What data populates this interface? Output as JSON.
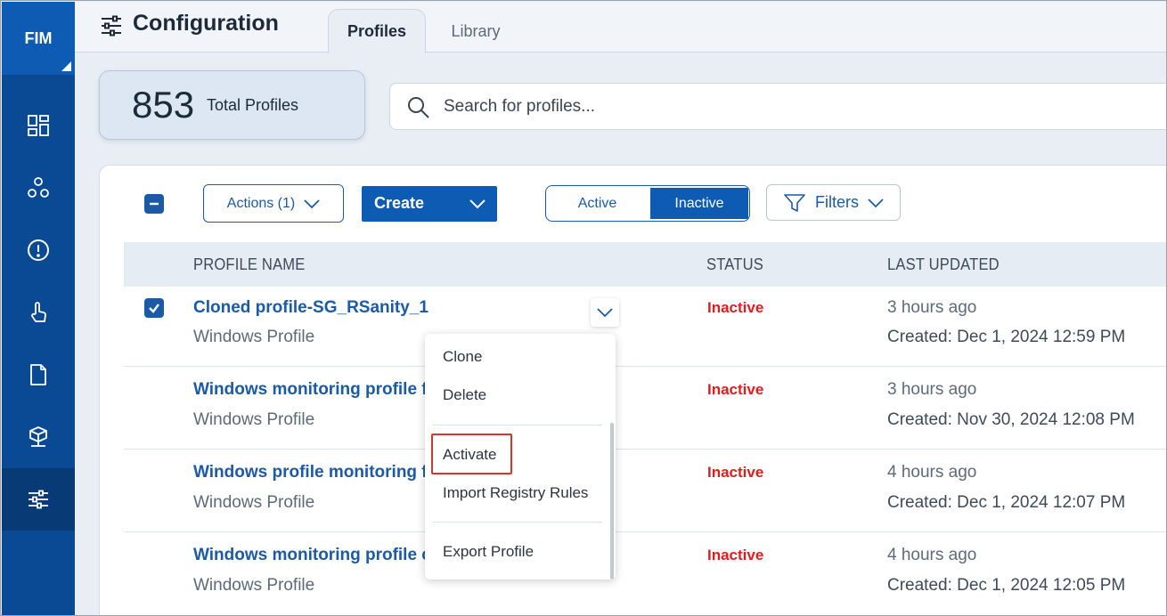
{
  "app": {
    "brand": "FIM"
  },
  "sidebar": {
    "items": [
      {
        "icon": "dashboard-icon"
      },
      {
        "icon": "network-nodes-icon"
      },
      {
        "icon": "alert-circle-icon"
      },
      {
        "icon": "touch-hand-icon"
      },
      {
        "icon": "document-icon"
      },
      {
        "icon": "package-icon"
      },
      {
        "icon": "sliders-icon",
        "active": true
      }
    ]
  },
  "header": {
    "title": "Configuration",
    "tabs": [
      {
        "label": "Profiles",
        "selected": true
      },
      {
        "label": "Library",
        "selected": false
      }
    ]
  },
  "stats": {
    "total": "853",
    "total_label": "Total Profiles"
  },
  "search": {
    "placeholder": "Search for profiles...",
    "value": ""
  },
  "toolbar": {
    "actions_label": "Actions (1)",
    "create_label": "Create",
    "status_active_label": "Active",
    "status_inactive_label": "Inactive",
    "status_selected": "Inactive",
    "filters_label": "Filters"
  },
  "table": {
    "columns": [
      "PROFILE NAME",
      "STATUS",
      "LAST UPDATED"
    ],
    "rows": [
      {
        "name": "Cloned profile-SG_RSanity_1",
        "type": "Windows Profile",
        "status": "Inactive",
        "updated": "3 hours ago",
        "created": "Created: Dec 1, 2024 12:59 PM",
        "checked": true
      },
      {
        "name": "Windows monitoring profile f",
        "type": "Windows Profile",
        "status": "Inactive",
        "updated": "3 hours ago",
        "created": "Created: Nov 30, 2024 12:08 PM",
        "checked": false
      },
      {
        "name": "Windows profile monitoring f",
        "type": "Windows Profile",
        "status": "Inactive",
        "updated": "4 hours ago",
        "created": "Created: Dec 1, 2024 12:07 PM",
        "checked": false
      },
      {
        "name": "Windows monitoring profile c",
        "type": "Windows Profile",
        "status": "Inactive",
        "updated": "4 hours ago",
        "created": "Created: Dec 1, 2024 12:05 PM",
        "checked": false
      }
    ]
  },
  "context_menu": {
    "items": [
      "Clone",
      "Delete",
      "Activate",
      "Import Registry Rules",
      "Export Profile"
    ],
    "highlighted": "Activate"
  },
  "colors": {
    "brand": "#0d5bb3",
    "sidebar": "#0a4a94",
    "status_inactive": "#e01d1d",
    "link": "#1b5aa6"
  }
}
